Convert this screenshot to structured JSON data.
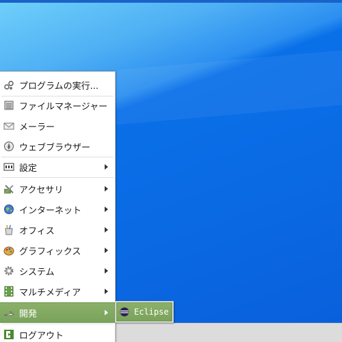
{
  "menu": {
    "items": [
      {
        "label": "プログラムの実行...",
        "icon": "run-program-icon",
        "submenu": false
      },
      {
        "label": "ファイルマネージャー",
        "icon": "file-manager-icon",
        "submenu": false
      },
      {
        "label": "メーラー",
        "icon": "mail-icon",
        "submenu": false
      },
      {
        "label": "ウェブブラウザー",
        "icon": "web-browser-icon",
        "submenu": false
      },
      {
        "label": "設定",
        "icon": "settings-icon",
        "submenu": true
      },
      {
        "label": "アクセサリ",
        "icon": "accessories-icon",
        "submenu": true
      },
      {
        "label": "インターネット",
        "icon": "internet-icon",
        "submenu": true
      },
      {
        "label": "オフィス",
        "icon": "office-icon",
        "submenu": true
      },
      {
        "label": "グラフィックス",
        "icon": "graphics-icon",
        "submenu": true
      },
      {
        "label": "システム",
        "icon": "system-icon",
        "submenu": true
      },
      {
        "label": "マルチメディア",
        "icon": "multimedia-icon",
        "submenu": true
      },
      {
        "label": "開発",
        "icon": "development-icon",
        "submenu": true,
        "active": true
      },
      {
        "label": "ログアウト",
        "icon": "logout-icon",
        "submenu": false
      }
    ]
  },
  "submenu": {
    "items": [
      {
        "label": "Eclipse",
        "icon": "eclipse-icon"
      }
    ]
  },
  "colors": {
    "highlight": "#7aa35a",
    "desktop": "#0a6ae4"
  }
}
